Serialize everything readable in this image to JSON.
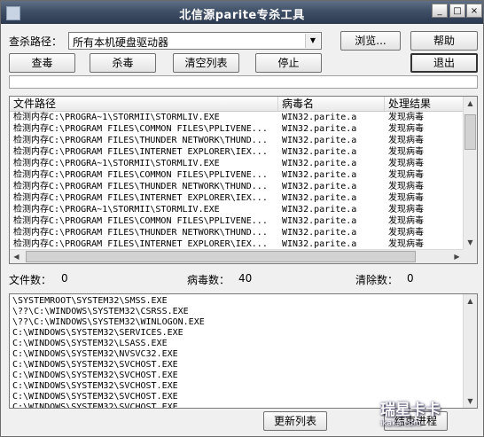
{
  "window": {
    "title": "北信源parite专杀工具"
  },
  "titlebar": {
    "min_glyph": "_",
    "max_glyph": "□",
    "close_glyph": "×"
  },
  "scan": {
    "path_label": "查杀路径：",
    "path_value": "所有本机硬盘驱动器",
    "dropdown_glyph": "▼"
  },
  "buttons": {
    "browse": "浏览...",
    "help": "帮助",
    "scan": "查毒",
    "kill": "杀毒",
    "clear_list": "清空列表",
    "stop": "停止",
    "exit": "退出",
    "refresh_list": "更新列表",
    "end_process": "结束进程"
  },
  "progress": {
    "value": 0
  },
  "results": {
    "columns": [
      "文件路径",
      "病毒名",
      "处理结果"
    ],
    "rows": [
      [
        "检测内存C:\\PROGRA~1\\STORMII\\STORMLIV.EXE",
        "WIN32.parite.a",
        "发现病毒"
      ],
      [
        "检测内存C:\\PROGRAM FILES\\COMMON FILES\\PPLIVENE...",
        "WIN32.parite.a",
        "发现病毒"
      ],
      [
        "检测内存C:\\PROGRAM FILES\\THUNDER NETWORK\\THUND...",
        "WIN32.parite.a",
        "发现病毒"
      ],
      [
        "检测内存C:\\PROGRAM FILES\\INTERNET EXPLORER\\IEX...",
        "WIN32.parite.a",
        "发现病毒"
      ],
      [
        "检测内存C:\\PROGRA~1\\STORMII\\STORMLIV.EXE",
        "WIN32.parite.a",
        "发现病毒"
      ],
      [
        "检测内存C:\\PROGRAM FILES\\COMMON FILES\\PPLIVENE...",
        "WIN32.parite.a",
        "发现病毒"
      ],
      [
        "检测内存C:\\PROGRAM FILES\\THUNDER NETWORK\\THUND...",
        "WIN32.parite.a",
        "发现病毒"
      ],
      [
        "检测内存C:\\PROGRAM FILES\\INTERNET EXPLORER\\IEX...",
        "WIN32.parite.a",
        "发现病毒"
      ],
      [
        "检测内存C:\\PROGRA~1\\STORMII\\STORMLIV.EXE",
        "WIN32.parite.a",
        "发现病毒"
      ],
      [
        "检测内存C:\\PROGRAM FILES\\COMMON FILES\\PPLIVENE...",
        "WIN32.parite.a",
        "发现病毒"
      ],
      [
        "检测内存C:\\PROGRAM FILES\\THUNDER NETWORK\\THUND...",
        "WIN32.parite.a",
        "发现病毒"
      ],
      [
        "检测内存C:\\PROGRAM FILES\\INTERNET EXPLORER\\IEX...",
        "WIN32.parite.a",
        "发现病毒"
      ]
    ]
  },
  "scroll": {
    "up": "▲",
    "down": "▼",
    "left": "◀",
    "right": "▶"
  },
  "stats": {
    "files_label": "文件数：",
    "files_value": "0",
    "virus_label": "病毒数：",
    "virus_value": "40",
    "cleaned_label": "清除数：",
    "cleaned_value": "0"
  },
  "processes": [
    "\\SYSTEMROOT\\SYSTEM32\\SMSS.EXE",
    "\\??\\C:\\WINDOWS\\SYSTEM32\\CSRSS.EXE",
    "\\??\\C:\\WINDOWS\\SYSTEM32\\WINLOGON.EXE",
    "C:\\WINDOWS\\SYSTEM32\\SERVICES.EXE",
    "C:\\WINDOWS\\SYSTEM32\\LSASS.EXE",
    "C:\\WINDOWS\\SYSTEM32\\NVSVC32.EXE",
    "C:\\WINDOWS\\SYSTEM32\\SVCHOST.EXE",
    "C:\\WINDOWS\\SYSTEM32\\SVCHOST.EXE",
    "C:\\WINDOWS\\SYSTEM32\\SVCHOST.EXE",
    "C:\\WINDOWS\\SYSTEM32\\SVCHOST.EXE",
    "C:\\WINDOWS\\SYSTEM32\\SVCHOST.EXE"
  ],
  "watermark": {
    "line1": "瑞星卡卡",
    "line2": "ikaka.com"
  }
}
